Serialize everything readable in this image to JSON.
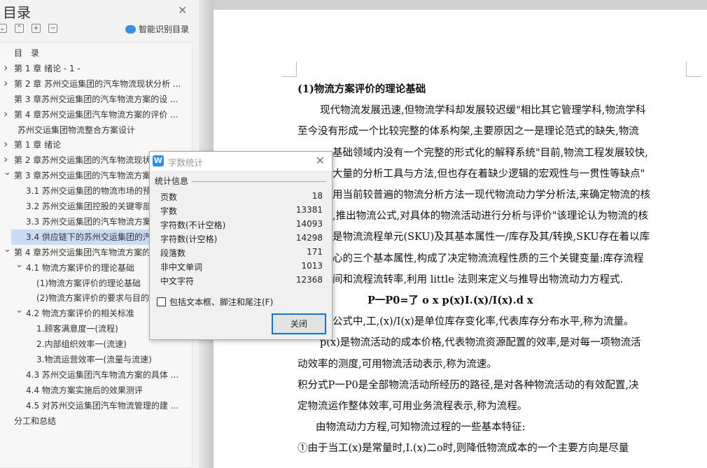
{
  "sidebar": {
    "title": "目录",
    "smart_toc": "智能识别目录",
    "items": [
      {
        "label": "目　录",
        "level": 0,
        "chevron": ""
      },
      {
        "label": "第 1 章  绪论  - 1 -",
        "level": 0,
        "chevron": "right"
      },
      {
        "label": "第 2 章  苏州交运集团的汽车物流现状分析 ...",
        "level": 0,
        "chevron": "right"
      },
      {
        "label": "第 3 章苏州交运集团的汽车物流方案的设 ...",
        "level": 0,
        "chevron": ""
      },
      {
        "label": "第 4 章苏州交运集团汽车物流方案的评价  ...",
        "level": 0,
        "chevron": "right"
      },
      {
        "label": "苏州交运集团物流整合方案设计",
        "level": 0.3,
        "chevron": ""
      },
      {
        "label": "第 1 章  绪论",
        "level": 0,
        "chevron": "right"
      },
      {
        "label": "第 2 章苏州交运集团的汽车物流现状分析",
        "level": 0,
        "chevron": "right"
      },
      {
        "label": "第 3 章苏州交运集团的汽车物流方案的设计",
        "level": 0,
        "chevron": "down"
      },
      {
        "label": "3.1 苏州交运集团的物流市场的预测",
        "level": 1,
        "chevron": ""
      },
      {
        "label": "3.2 苏州交运集团控股的关键零部件",
        "level": 1,
        "chevron": ""
      },
      {
        "label": "3.3 苏州交运集团的汽车物流方案",
        "level": 1,
        "chevron": ""
      },
      {
        "label": "3.4 供应链下的苏州交运集团的汽车",
        "level": 1,
        "chevron": "",
        "selected": true
      },
      {
        "label": "第 4 章苏州交运集团汽车物流方案的评价",
        "level": 0,
        "chevron": "down"
      },
      {
        "label": "4.1 物流方案评价的理论基础",
        "level": 1,
        "chevron": "down"
      },
      {
        "label": "(1)物流方案评价的理论基础",
        "level": 2,
        "chevron": ""
      },
      {
        "label": "(2)物流方案评价的要求与目的",
        "level": 2,
        "chevron": ""
      },
      {
        "label": "4.2 物流方案评价的相关标准",
        "level": 1,
        "chevron": "down"
      },
      {
        "label": "1.顾客满意度一(流程)",
        "level": 2,
        "chevron": ""
      },
      {
        "label": "2.内部组织效率一(流速)",
        "level": 2,
        "chevron": ""
      },
      {
        "label": "3.物流运营效率一(流量与流速)",
        "level": 2,
        "chevron": ""
      },
      {
        "label": "4.3 苏州交运集团汽车物流方案的具体 ...",
        "level": 1,
        "chevron": ""
      },
      {
        "label": "4.4 物流方案实施后的效果测评",
        "level": 1,
        "chevron": ""
      },
      {
        "label": "4.5 对苏州交运集团汽车物流管理的建 ...",
        "level": 1,
        "chevron": ""
      },
      {
        "label": "分工和总结",
        "level": 0,
        "chevron": ""
      }
    ]
  },
  "document": {
    "lines": [
      {
        "text": "(1)物流方案评价的理论基础",
        "bold": true,
        "indent": 0
      },
      {
        "text": "现代物流发展迅速,但物流学科却发展较迟缓\"相比其它管理学科,物流学科",
        "indent": 32
      },
      {
        "text": "至今没有形成一个比较完整的体系构架,主要原因之一是理论范式的缺失,物流",
        "indent": 0
      },
      {
        "text": "基础领域内没有一个完整的形式化的解释系统\"目前,物流工程发展较快,",
        "indent": 50
      },
      {
        "text": "大量的分析工具与方法,但也存在着缺少逻辑的宏观性与一贯性等缺点\"",
        "indent": 50
      },
      {
        "text": "用当前较普遍的物流分析方法一现代物流动力学分析法,来确定物流的核",
        "indent": 50
      },
      {
        "text": ",推出物流公式,对具体的物流活动进行分析与评价\"该理论认为物流的核",
        "indent": 50
      },
      {
        "text": "是物流流程单元(SKU)及其基本属性一/库存及其/转换,SKU存在着以库",
        "indent": 50
      },
      {
        "text": "心的三个基本属性,构成了决定物流流程性质的三个关键变量:库存流程",
        "indent": 50
      },
      {
        "text": "间和流程流转率,利用 little 法则来定义与推导出物流动力方程式.",
        "indent": 50
      },
      {
        "text": "P一P0=了 o x p(x)I.(x)/I(x).d x",
        "bold": true,
        "indent": 100
      },
      {
        "text": "公式中,工,(x)/I(x)是单位库存变化率,代表库存分布水平,称为流量。",
        "indent": 50
      },
      {
        "text": "p(x)是物流活动的成本价格,代表物流资源配置的效率,是对每一项物流活",
        "indent": 32
      },
      {
        "text": "动效率的测度,可用物流活动表示,称为流速。",
        "indent": 0
      },
      {
        "text": "积分式P一P0是全部物流活动所经历的路径,是对各种物流活动的有效配置,决",
        "indent": 0
      },
      {
        "text": "定物流运作整体效率,可用业务流程表示,称为流程。",
        "indent": 0
      },
      {
        "text": "由物流动力方程,可知物流过程的一些基本特征:",
        "indent": 26
      },
      {
        "text": "①由于当工(x)是常量时,I.(x)二o时,则降低物流成本的一个主要方向是尽量",
        "indent": 0
      }
    ]
  },
  "dialog": {
    "title": "字数统计",
    "group": "统计信息",
    "stats": [
      {
        "label": "页数",
        "value": "18"
      },
      {
        "label": "字数",
        "value": "13381"
      },
      {
        "label": "字符数(不计空格)",
        "value": "14093"
      },
      {
        "label": "字符数(计空格)",
        "value": "14298"
      },
      {
        "label": "段落数",
        "value": "171"
      },
      {
        "label": "非中文单词",
        "value": "1013"
      },
      {
        "label": "中文字符",
        "value": "12368"
      }
    ],
    "checkbox_label": "包括文本框、脚注和尾注(F)",
    "checkbox_checked": false,
    "close_label": "关闭"
  },
  "colors": {
    "accent": "#0a78d7",
    "selected": "#cadcf4"
  }
}
